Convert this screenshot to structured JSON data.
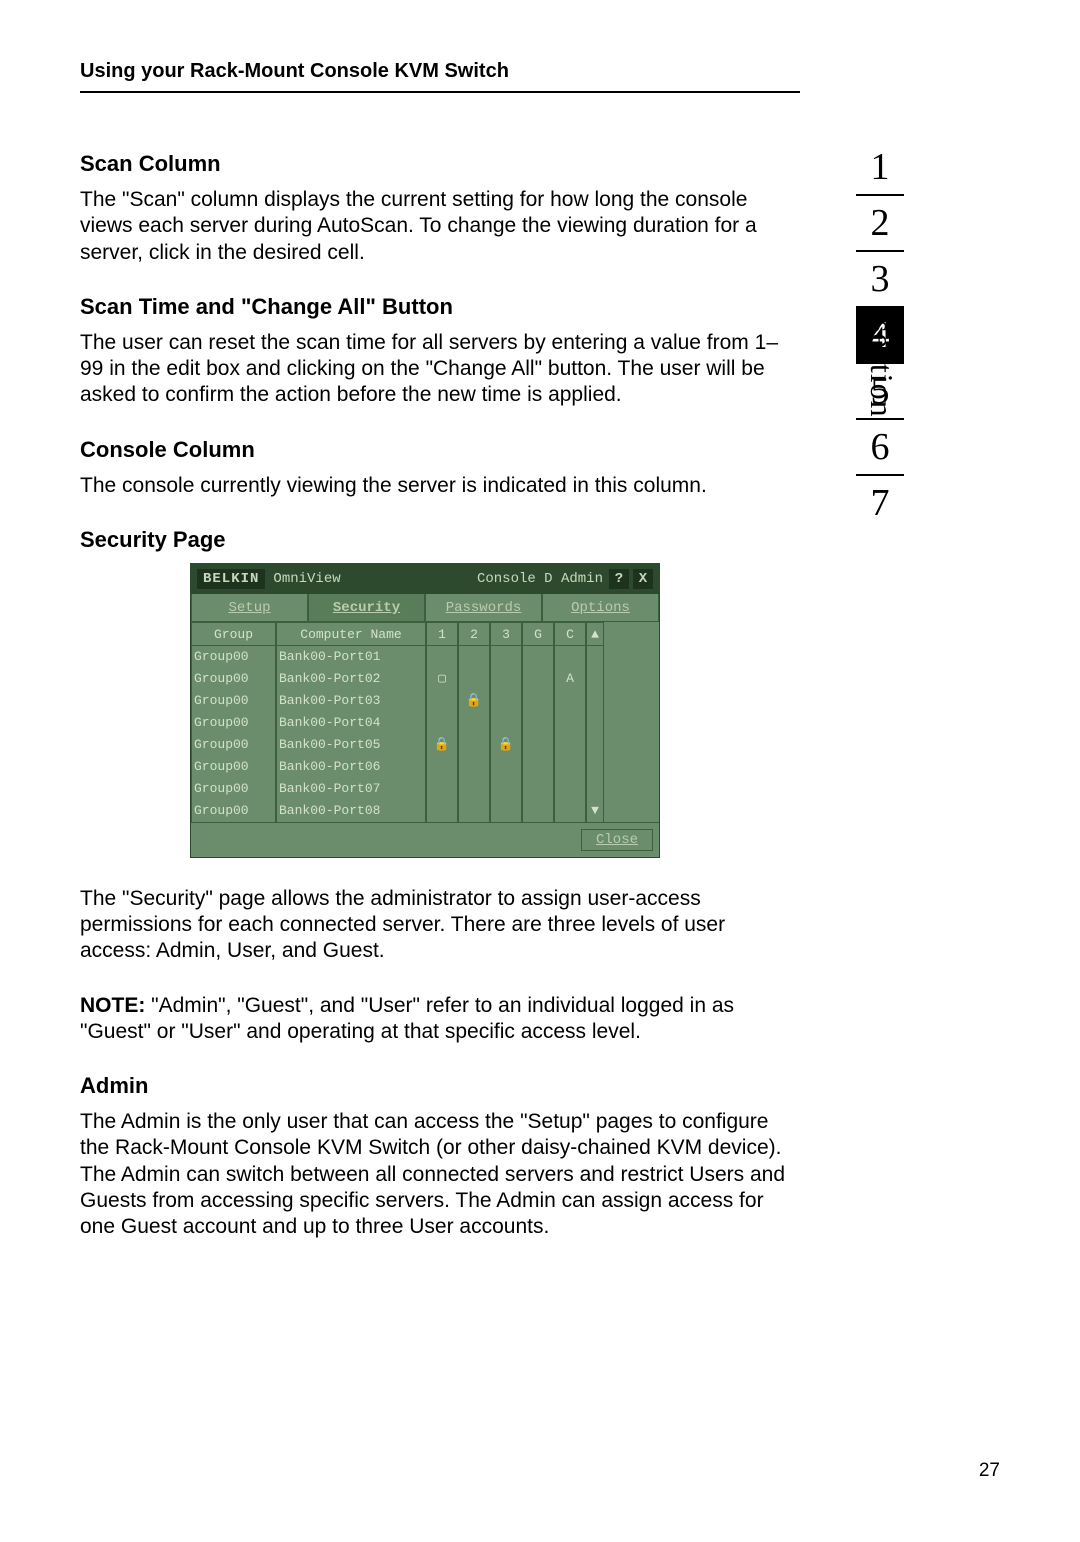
{
  "header": {
    "title": "Using your Rack-Mount Console KVM Switch"
  },
  "sections": {
    "scan_column": {
      "heading": "Scan Column",
      "body": "The \"Scan\" column displays the current setting for how long the console views each server during AutoScan. To change the viewing duration for a server, click in the desired cell."
    },
    "scan_time": {
      "heading": "Scan Time and \"Change All\" Button",
      "body": "The user can reset the scan time for all servers by entering a value from 1–99 in the edit box and clicking on the \"Change All\" button. The user will be asked to confirm the action before the new time is applied."
    },
    "console_column": {
      "heading": "Console Column",
      "body": "The console currently viewing the server is indicated in this column."
    },
    "security_page": {
      "heading": "Security Page",
      "body_after": "The \"Security\" page allows the administrator to assign user-access permissions for each connected server. There are three levels of user access: Admin, User, and Guest.",
      "note_label": "NOTE:",
      "note_body": " \"Admin\", \"Guest\", and \"User\" refer to an individual logged in as \"Guest\" or \"User\" and operating at that specific access level."
    },
    "admin": {
      "heading": "Admin",
      "body": "The Admin is the only user that can access the \"Setup\" pages to configure the Rack-Mount Console KVM Switch (or other daisy-chained KVM device). The Admin can switch between all connected servers and restrict Users and Guests from accessing specific servers. The Admin can assign access for one Guest account and up to three User accounts."
    }
  },
  "osd": {
    "brand": "BELKIN",
    "product": "OmniView",
    "title_right": "Console D Admin",
    "help_icon": "?",
    "close_icon": "X",
    "tabs": {
      "setup": "Setup",
      "security": "Security",
      "passwords": "Passwords",
      "options": "Options"
    },
    "columns": {
      "group": "Group",
      "name": "Computer Name",
      "c1": "1",
      "c2": "2",
      "c3": "3",
      "g": "G",
      "c": "C"
    },
    "rows": [
      {
        "group": "Group00",
        "name": "Bank00-Port01",
        "c1": "",
        "c2": "",
        "c3": "",
        "g": "",
        "c": ""
      },
      {
        "group": "Group00",
        "name": "Bank00-Port02",
        "c1": "▢",
        "c2": "",
        "c3": "",
        "g": "",
        "c": "A"
      },
      {
        "group": "Group00",
        "name": "Bank00-Port03",
        "c1": "",
        "c2": "🔒",
        "c3": "",
        "g": "",
        "c": ""
      },
      {
        "group": "Group00",
        "name": "Bank00-Port04",
        "c1": "",
        "c2": "",
        "c3": "",
        "g": "",
        "c": ""
      },
      {
        "group": "Group00",
        "name": "Bank00-Port05",
        "c1": "🔒",
        "c2": "",
        "c3": "🔒",
        "g": "",
        "c": ""
      },
      {
        "group": "Group00",
        "name": "Bank00-Port06",
        "c1": "",
        "c2": "",
        "c3": "",
        "g": "",
        "c": ""
      },
      {
        "group": "Group00",
        "name": "Bank00-Port07",
        "c1": "",
        "c2": "",
        "c3": "",
        "g": "",
        "c": ""
      },
      {
        "group": "Group00",
        "name": "Bank00-Port08",
        "c1": "",
        "c2": "",
        "c3": "",
        "g": "",
        "c": ""
      }
    ],
    "scroll_up": "▲",
    "scroll_down": "▼",
    "close_btn": "Close"
  },
  "sidebar": {
    "label": "section",
    "items": [
      "1",
      "2",
      "3",
      "4",
      "5",
      "6",
      "7"
    ],
    "active_index": 3
  },
  "page_number": "27"
}
